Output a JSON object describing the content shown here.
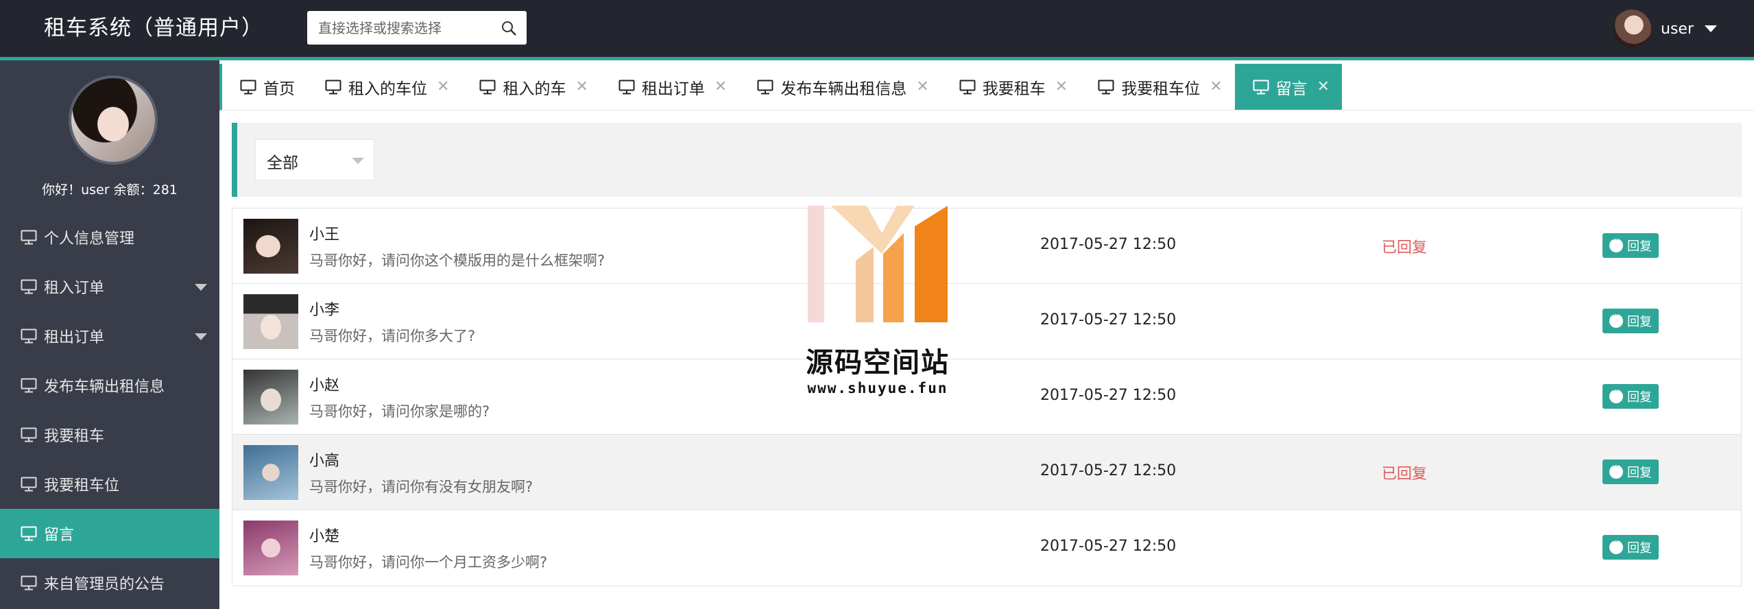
{
  "header": {
    "title": "租车系统（普通用户）",
    "search_placeholder": "直接选择或搜索选择",
    "username": "user"
  },
  "sidebar": {
    "greeting": "你好！user 余额：281",
    "items": [
      {
        "label": "个人信息管理",
        "icon": "monitor-icon",
        "has_submenu": false,
        "active": false
      },
      {
        "label": "租入订单",
        "icon": "monitor-icon",
        "has_submenu": true,
        "active": false
      },
      {
        "label": "租出订单",
        "icon": "monitor-icon",
        "has_submenu": true,
        "active": false
      },
      {
        "label": "发布车辆出租信息",
        "icon": "monitor-icon",
        "has_submenu": false,
        "active": false
      },
      {
        "label": "我要租车",
        "icon": "monitor-icon",
        "has_submenu": false,
        "active": false
      },
      {
        "label": "我要租车位",
        "icon": "monitor-icon",
        "has_submenu": false,
        "active": false
      },
      {
        "label": "留言",
        "icon": "monitor-icon",
        "has_submenu": false,
        "active": true
      },
      {
        "label": "来自管理员的公告",
        "icon": "monitor-icon",
        "has_submenu": false,
        "active": false
      }
    ]
  },
  "tabs": [
    {
      "label": "首页",
      "closable": false,
      "active": false
    },
    {
      "label": "租入的车位",
      "closable": true,
      "active": false
    },
    {
      "label": "租入的车",
      "closable": true,
      "active": false
    },
    {
      "label": "租出订单",
      "closable": true,
      "active": false
    },
    {
      "label": "发布车辆出租信息",
      "closable": true,
      "active": false
    },
    {
      "label": "我要租车",
      "closable": true,
      "active": false
    },
    {
      "label": "我要租车位",
      "closable": true,
      "active": false
    },
    {
      "label": "留言",
      "closable": true,
      "active": true
    }
  ],
  "filter": {
    "selected": "全部"
  },
  "messages": [
    {
      "name": "小王",
      "text": "马哥你好，请问你这个模版用的是什么框架啊?",
      "time": "2017-05-27 12:50",
      "status": "已回复",
      "reply_label": "回复"
    },
    {
      "name": "小李",
      "text": "马哥你好，请问你多大了?",
      "time": "2017-05-27 12:50",
      "status": "",
      "reply_label": "回复"
    },
    {
      "name": "小赵",
      "text": "马哥你好，请问你家是哪的?",
      "time": "2017-05-27 12:50",
      "status": "",
      "reply_label": "回复"
    },
    {
      "name": "小高",
      "text": "马哥你好，请问你有没有女朋友啊?",
      "time": "2017-05-27 12:50",
      "status": "已回复",
      "reply_label": "回复"
    },
    {
      "name": "小楚",
      "text": "马哥你好，请问你一个月工资多少啊?",
      "time": "2017-05-27 12:50",
      "status": "",
      "reply_label": "回复"
    }
  ],
  "watermark": {
    "title": "源码空间站",
    "url": "www.shuyue.fun"
  },
  "colors": {
    "accent": "#2ea697",
    "header_bg": "#23262e",
    "sidebar_bg": "#393d49",
    "status_red": "#e05a5a"
  }
}
